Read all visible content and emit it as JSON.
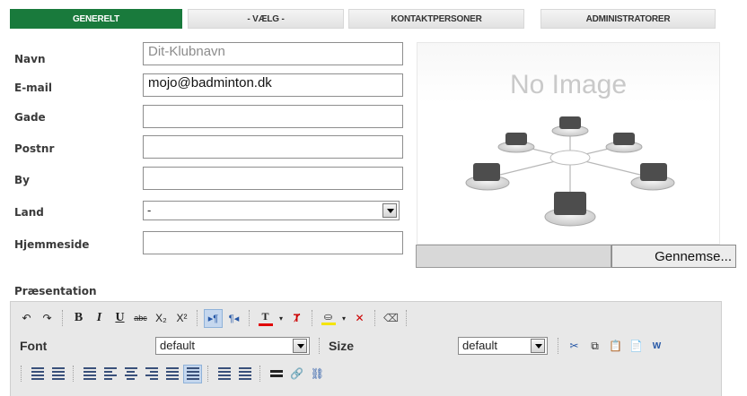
{
  "tabs": [
    {
      "label": "GENERELT",
      "active": true
    },
    {
      "label": "- VÆLG -",
      "active": false
    },
    {
      "label": "KONTAKTPERSONER",
      "active": false
    },
    {
      "label": "ADMINISTRATORER",
      "active": false
    }
  ],
  "form": {
    "navn": {
      "label": "Navn",
      "value": "Dit-Klubnavn"
    },
    "email": {
      "label": "E-mail",
      "value": "mojo@badminton.dk"
    },
    "gade": {
      "label": "Gade",
      "value": ""
    },
    "postnr": {
      "label": "Postnr",
      "value": ""
    },
    "by": {
      "label": "By",
      "value": ""
    },
    "land": {
      "label": "Land",
      "value": "-"
    },
    "hjemmeside": {
      "label": "Hjemmeside",
      "value": ""
    }
  },
  "image": {
    "placeholder_text": "No Image",
    "browse_label": "Gennemse..."
  },
  "editor": {
    "section_label": "Præsentation",
    "font_label": "Font",
    "font_value": "default",
    "size_label": "Size",
    "size_value": "default",
    "toolbar1": {
      "bold": "B",
      "italic": "I",
      "underline": "U",
      "strike": "abc",
      "sub": "X₂",
      "sup": "X²",
      "textcolor": "T"
    }
  },
  "colors": {
    "accent": "#197a3c",
    "text_color_bar": "#e00000",
    "highlight_bar": "#f4e400"
  }
}
